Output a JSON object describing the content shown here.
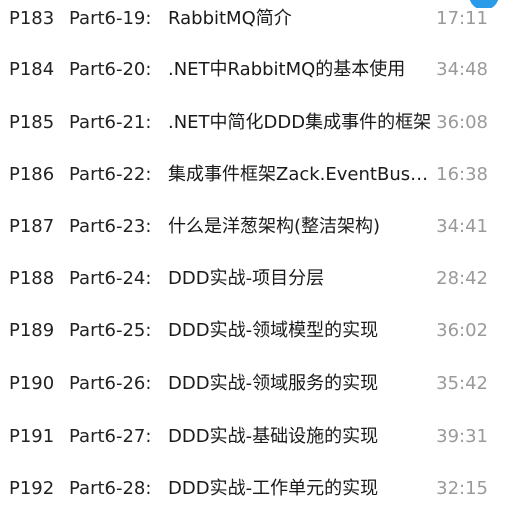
{
  "episodes": [
    {
      "p": "P183",
      "part": "Part6-19:",
      "title": "RabbitMQ简介",
      "duration": "17:11"
    },
    {
      "p": "P184",
      "part": "Part6-20:",
      "title": ".NET中RabbitMQ的基本使用",
      "duration": "34:48"
    },
    {
      "p": "P185",
      "part": "Part6-21:",
      "title": ".NET中简化DDD集成事件的框架",
      "duration": "36:08"
    },
    {
      "p": "P186",
      "part": "Part6-22:",
      "title": "集成事件框架Zack.EventBus的使用",
      "duration": "16:38"
    },
    {
      "p": "P187",
      "part": "Part6-23:",
      "title": "什么是洋葱架构(整洁架构)",
      "duration": "34:41"
    },
    {
      "p": "P188",
      "part": "Part6-24:",
      "title": "DDD实战-项目分层",
      "duration": "28:42"
    },
    {
      "p": "P189",
      "part": "Part6-25:",
      "title": "DDD实战-领域模型的实现",
      "duration": "36:02"
    },
    {
      "p": "P190",
      "part": "Part6-26:",
      "title": "DDD实战-领域服务的实现",
      "duration": "35:42"
    },
    {
      "p": "P191",
      "part": "Part6-27:",
      "title": "DDD实战-基础设施的实现",
      "duration": "39:31"
    },
    {
      "p": "P192",
      "part": "Part6-28:",
      "title": "DDD实战-工作单元的实现",
      "duration": "32:15"
    }
  ],
  "colors": {
    "text": "#1f1f1f",
    "duration": "#9a9a9a",
    "accent": "#2a9be8"
  }
}
